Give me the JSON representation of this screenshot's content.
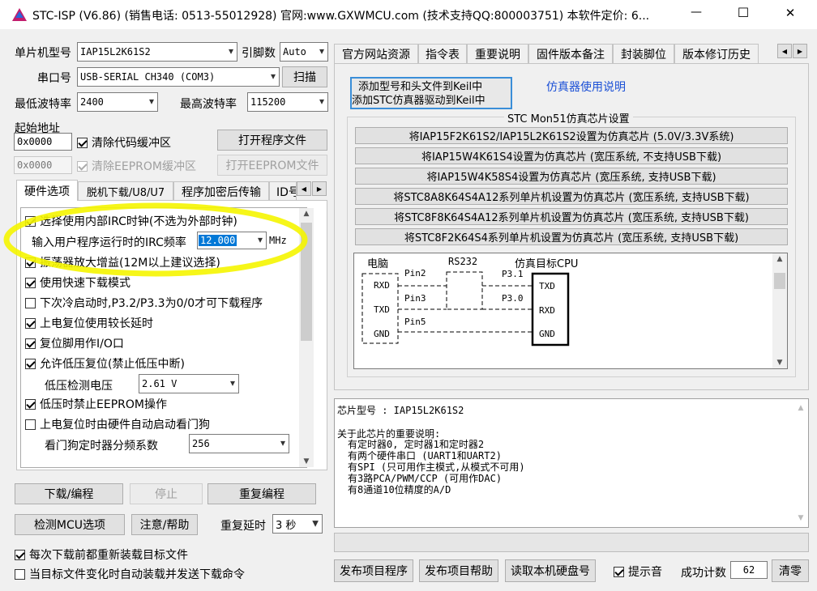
{
  "window": {
    "title": "STC-ISP (V6.86) (销售电话: 0513-55012928) 官网:www.GXWMCU.com  (技术支持QQ:800003751) 本软件定价: 6...",
    "minimize": "—",
    "maximize": "☐",
    "close": "✕"
  },
  "left": {
    "mcu_type_label": "单片机型号",
    "mcu_type_value": "IAP15L2K61S2",
    "pins_label": "引脚数",
    "pins_value": "Auto",
    "port_label": "串口号",
    "port_value": "USB-SERIAL CH340 (COM3)",
    "scan_button": "扫描",
    "min_baud_label": "最低波特率",
    "min_baud_value": "2400",
    "max_baud_label": "最高波特率",
    "max_baud_value": "115200",
    "start_addr_label": "起始地址",
    "code_addr": "0x0000",
    "clear_code_label": "清除代码缓冲区",
    "open_program_button": "打开程序文件",
    "eeprom_addr": "0x0000",
    "clear_eeprom_label": "清除EEPROM缓冲区",
    "open_eeprom_button": "打开EEPROM文件"
  },
  "hw_tabs": [
    "硬件选项",
    "脱机下载/U8/U7",
    "程序加密后传输",
    "ID号"
  ],
  "hw_options": {
    "irc_label": "选择使用内部IRC时钟(不选为外部时钟)",
    "irc_freq_label": "输入用户程序运行时的IRC频率",
    "irc_freq_value": "12.000",
    "irc_freq_unit": "MHz",
    "osc_gain_label": "振荡器放大增益(12M以上建议选择)",
    "fast_download_label": "使用快速下载模式",
    "cold_start_label": "下次冷启动时,P3.2/P3.3为0/0才可下载程序",
    "long_delay_label": "上电复位使用较长延时",
    "reset_pin_label": "复位脚用作I/O口",
    "lvr_label": "允许低压复位(禁止低压中断)",
    "lv_detect_label": "低压检测电压",
    "lv_detect_value": "2.61 V",
    "eeprom_lv_label": "低压时禁止EEPROM操作",
    "wdt_label": "上电复位时由硬件自动启动看门狗",
    "wdt_div_label": "看门狗定时器分频系数",
    "wdt_div_value": "256"
  },
  "actions": {
    "download": "下载/编程",
    "stop": "停止",
    "reprogram": "重复编程",
    "check_mcu": "检测MCU选项",
    "help": "注意/帮助",
    "repeat_delay_label": "重复延时",
    "repeat_delay_value": "3 秒",
    "reload_label": "每次下载前都重新装载目标文件",
    "auto_send_label": "当目标文件变化时自动装载并发送下载命令"
  },
  "right_tabs": [
    "官方网站资源",
    "指令表",
    "重要说明",
    "固件版本备注",
    "封装脚位",
    "版本修订历史"
  ],
  "emulator": {
    "keil_button_line1": "添加型号和头文件到Keil中",
    "keil_button_line2": "添加STC仿真器驱动到Keil中",
    "manual_link": "仿真器使用说明",
    "group_title": "STC Mon51仿真芯片设置",
    "set_buttons": [
      "将IAP15F2K61S2/IAP15L2K61S2设置为仿真芯片 (5.0V/3.3V系统)",
      "将IAP15W4K61S4设置为仿真芯片 (宽压系统, 不支持USB下载)",
      "将IAP15W4K58S4设置为仿真芯片 (宽压系统, 支持USB下载)",
      "将STC8A8K64S4A12系列单片机设置为仿真芯片 (宽压系统, 支持USB下载)",
      "将STC8F8K64S4A12系列单片机设置为仿真芯片 (宽压系统, 支持USB下载)",
      "将STC8F2K64S4系列单片机设置为仿真芯片 (宽压系统, 支持USB下载)"
    ],
    "diagram": {
      "pc_label": "电脑",
      "rs232_label": "RS232",
      "target_label": "仿真目标CPU",
      "pc_pins": [
        "RXD",
        "TXD",
        "GND"
      ],
      "cable_pins": [
        "Pin2",
        "Pin3",
        "Pin5"
      ],
      "cpu_ports": [
        "P3.1",
        "P3.0"
      ],
      "cpu_pins": [
        "TXD",
        "RXD",
        "GND"
      ]
    }
  },
  "info": {
    "chip_line": "芯片型号 : IAP15L2K61S2",
    "notes_title": "关于此芯片的重要说明:",
    "notes": [
      "有定时器0, 定时器1和定时器2",
      "有两个硬件串口 (UART1和UART2)",
      "有SPI (只可用作主模式,从模式不可用)",
      "有3路PCA/PWM/CCP (可用作DAC)",
      "有8通道10位精度的A/D"
    ]
  },
  "bottom": {
    "publish_program": "发布项目程序",
    "publish_help": "发布项目帮助",
    "read_disk_id": "读取本机硬盘号",
    "sound_label": "提示音",
    "success_count_label": "成功计数",
    "success_count_value": "62",
    "clear_button": "清零"
  },
  "colors": {
    "highlight": "#f5f500",
    "link_blue": "#1a4fd6",
    "selection": "#0078d7"
  }
}
